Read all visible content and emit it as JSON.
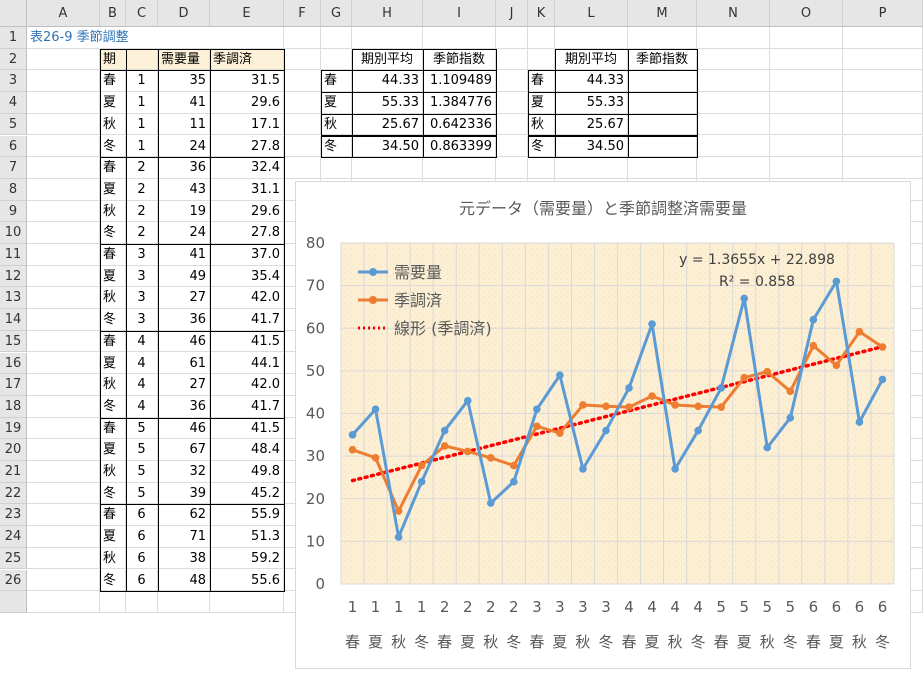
{
  "columns": [
    "A",
    "B",
    "C",
    "D",
    "E",
    "F",
    "G",
    "H",
    "I",
    "J",
    "K",
    "L",
    "M",
    "N",
    "O",
    "P"
  ],
  "title_cell": "表26-9 季節調整",
  "main_table": {
    "headers": [
      "期",
      "需要量",
      "季調済"
    ],
    "rows": [
      [
        "春",
        "1",
        "35",
        "31.5"
      ],
      [
        "夏",
        "1",
        "41",
        "29.6"
      ],
      [
        "秋",
        "1",
        "11",
        "17.1"
      ],
      [
        "冬",
        "1",
        "24",
        "27.8"
      ],
      [
        "春",
        "2",
        "36",
        "32.4"
      ],
      [
        "夏",
        "2",
        "43",
        "31.1"
      ],
      [
        "秋",
        "2",
        "19",
        "29.6"
      ],
      [
        "冬",
        "2",
        "24",
        "27.8"
      ],
      [
        "春",
        "3",
        "41",
        "37.0"
      ],
      [
        "夏",
        "3",
        "49",
        "35.4"
      ],
      [
        "秋",
        "3",
        "27",
        "42.0"
      ],
      [
        "冬",
        "3",
        "36",
        "41.7"
      ],
      [
        "春",
        "4",
        "46",
        "41.5"
      ],
      [
        "夏",
        "4",
        "61",
        "44.1"
      ],
      [
        "秋",
        "4",
        "27",
        "42.0"
      ],
      [
        "冬",
        "4",
        "36",
        "41.7"
      ],
      [
        "春",
        "5",
        "46",
        "41.5"
      ],
      [
        "夏",
        "5",
        "67",
        "48.4"
      ],
      [
        "秋",
        "5",
        "32",
        "49.8"
      ],
      [
        "冬",
        "5",
        "39",
        "45.2"
      ],
      [
        "春",
        "6",
        "62",
        "55.9"
      ],
      [
        "夏",
        "6",
        "71",
        "51.3"
      ],
      [
        "秋",
        "6",
        "38",
        "59.2"
      ],
      [
        "冬",
        "6",
        "48",
        "55.6"
      ]
    ]
  },
  "index_table1": {
    "headers": [
      "期別平均",
      "季節指数"
    ],
    "rows": [
      [
        "春",
        "44.33",
        "1.109489"
      ],
      [
        "夏",
        "55.33",
        "1.384776"
      ],
      [
        "秋",
        "25.67",
        "0.642336"
      ],
      [
        "冬",
        "34.50",
        "0.863399"
      ]
    ]
  },
  "index_table2": {
    "headers": [
      "期別平均",
      "季節指数"
    ],
    "rows": [
      [
        "春",
        "44.33",
        ""
      ],
      [
        "夏",
        "55.33",
        ""
      ],
      [
        "秋",
        "25.67",
        ""
      ],
      [
        "冬",
        "34.50",
        ""
      ]
    ]
  },
  "chart_data": {
    "type": "line",
    "title": "元データ（需要量）と季節調整済需要量",
    "categories_year": [
      "1",
      "1",
      "1",
      "1",
      "2",
      "2",
      "2",
      "2",
      "3",
      "3",
      "3",
      "3",
      "4",
      "4",
      "4",
      "4",
      "5",
      "5",
      "5",
      "5",
      "6",
      "6",
      "6",
      "6"
    ],
    "categories_season": [
      "春",
      "夏",
      "秋",
      "冬",
      "春",
      "夏",
      "秋",
      "冬",
      "春",
      "夏",
      "秋",
      "冬",
      "春",
      "夏",
      "秋",
      "冬",
      "春",
      "夏",
      "秋",
      "冬",
      "春",
      "夏",
      "秋",
      "冬"
    ],
    "series": [
      {
        "name": "需要量",
        "color": "#5b9bd5",
        "values": [
          35,
          41,
          11,
          24,
          36,
          43,
          19,
          24,
          41,
          49,
          27,
          36,
          46,
          61,
          27,
          36,
          46,
          67,
          32,
          39,
          62,
          71,
          38,
          48
        ]
      },
      {
        "name": "季調済",
        "color": "#ed7d31",
        "values": [
          31.5,
          29.6,
          17.1,
          27.8,
          32.4,
          31.1,
          29.6,
          27.8,
          37.0,
          35.4,
          42.0,
          41.7,
          41.5,
          44.1,
          42.0,
          41.7,
          41.5,
          48.4,
          49.8,
          45.2,
          55.9,
          51.3,
          59.2,
          55.6
        ]
      }
    ],
    "trendline": {
      "name": "線形 (季調済)",
      "color": "#ff0000",
      "slope": 1.3655,
      "intercept": 22.898,
      "equation": "y = 1.3655x + 22.898",
      "r2": "R² = 0.858"
    },
    "yticks": [
      "0",
      "10",
      "20",
      "30",
      "40",
      "50",
      "60",
      "70",
      "80"
    ],
    "ylim": [
      0,
      80
    ],
    "grid": true,
    "legend": "top-left",
    "plot_background": "#fdf0d5"
  }
}
